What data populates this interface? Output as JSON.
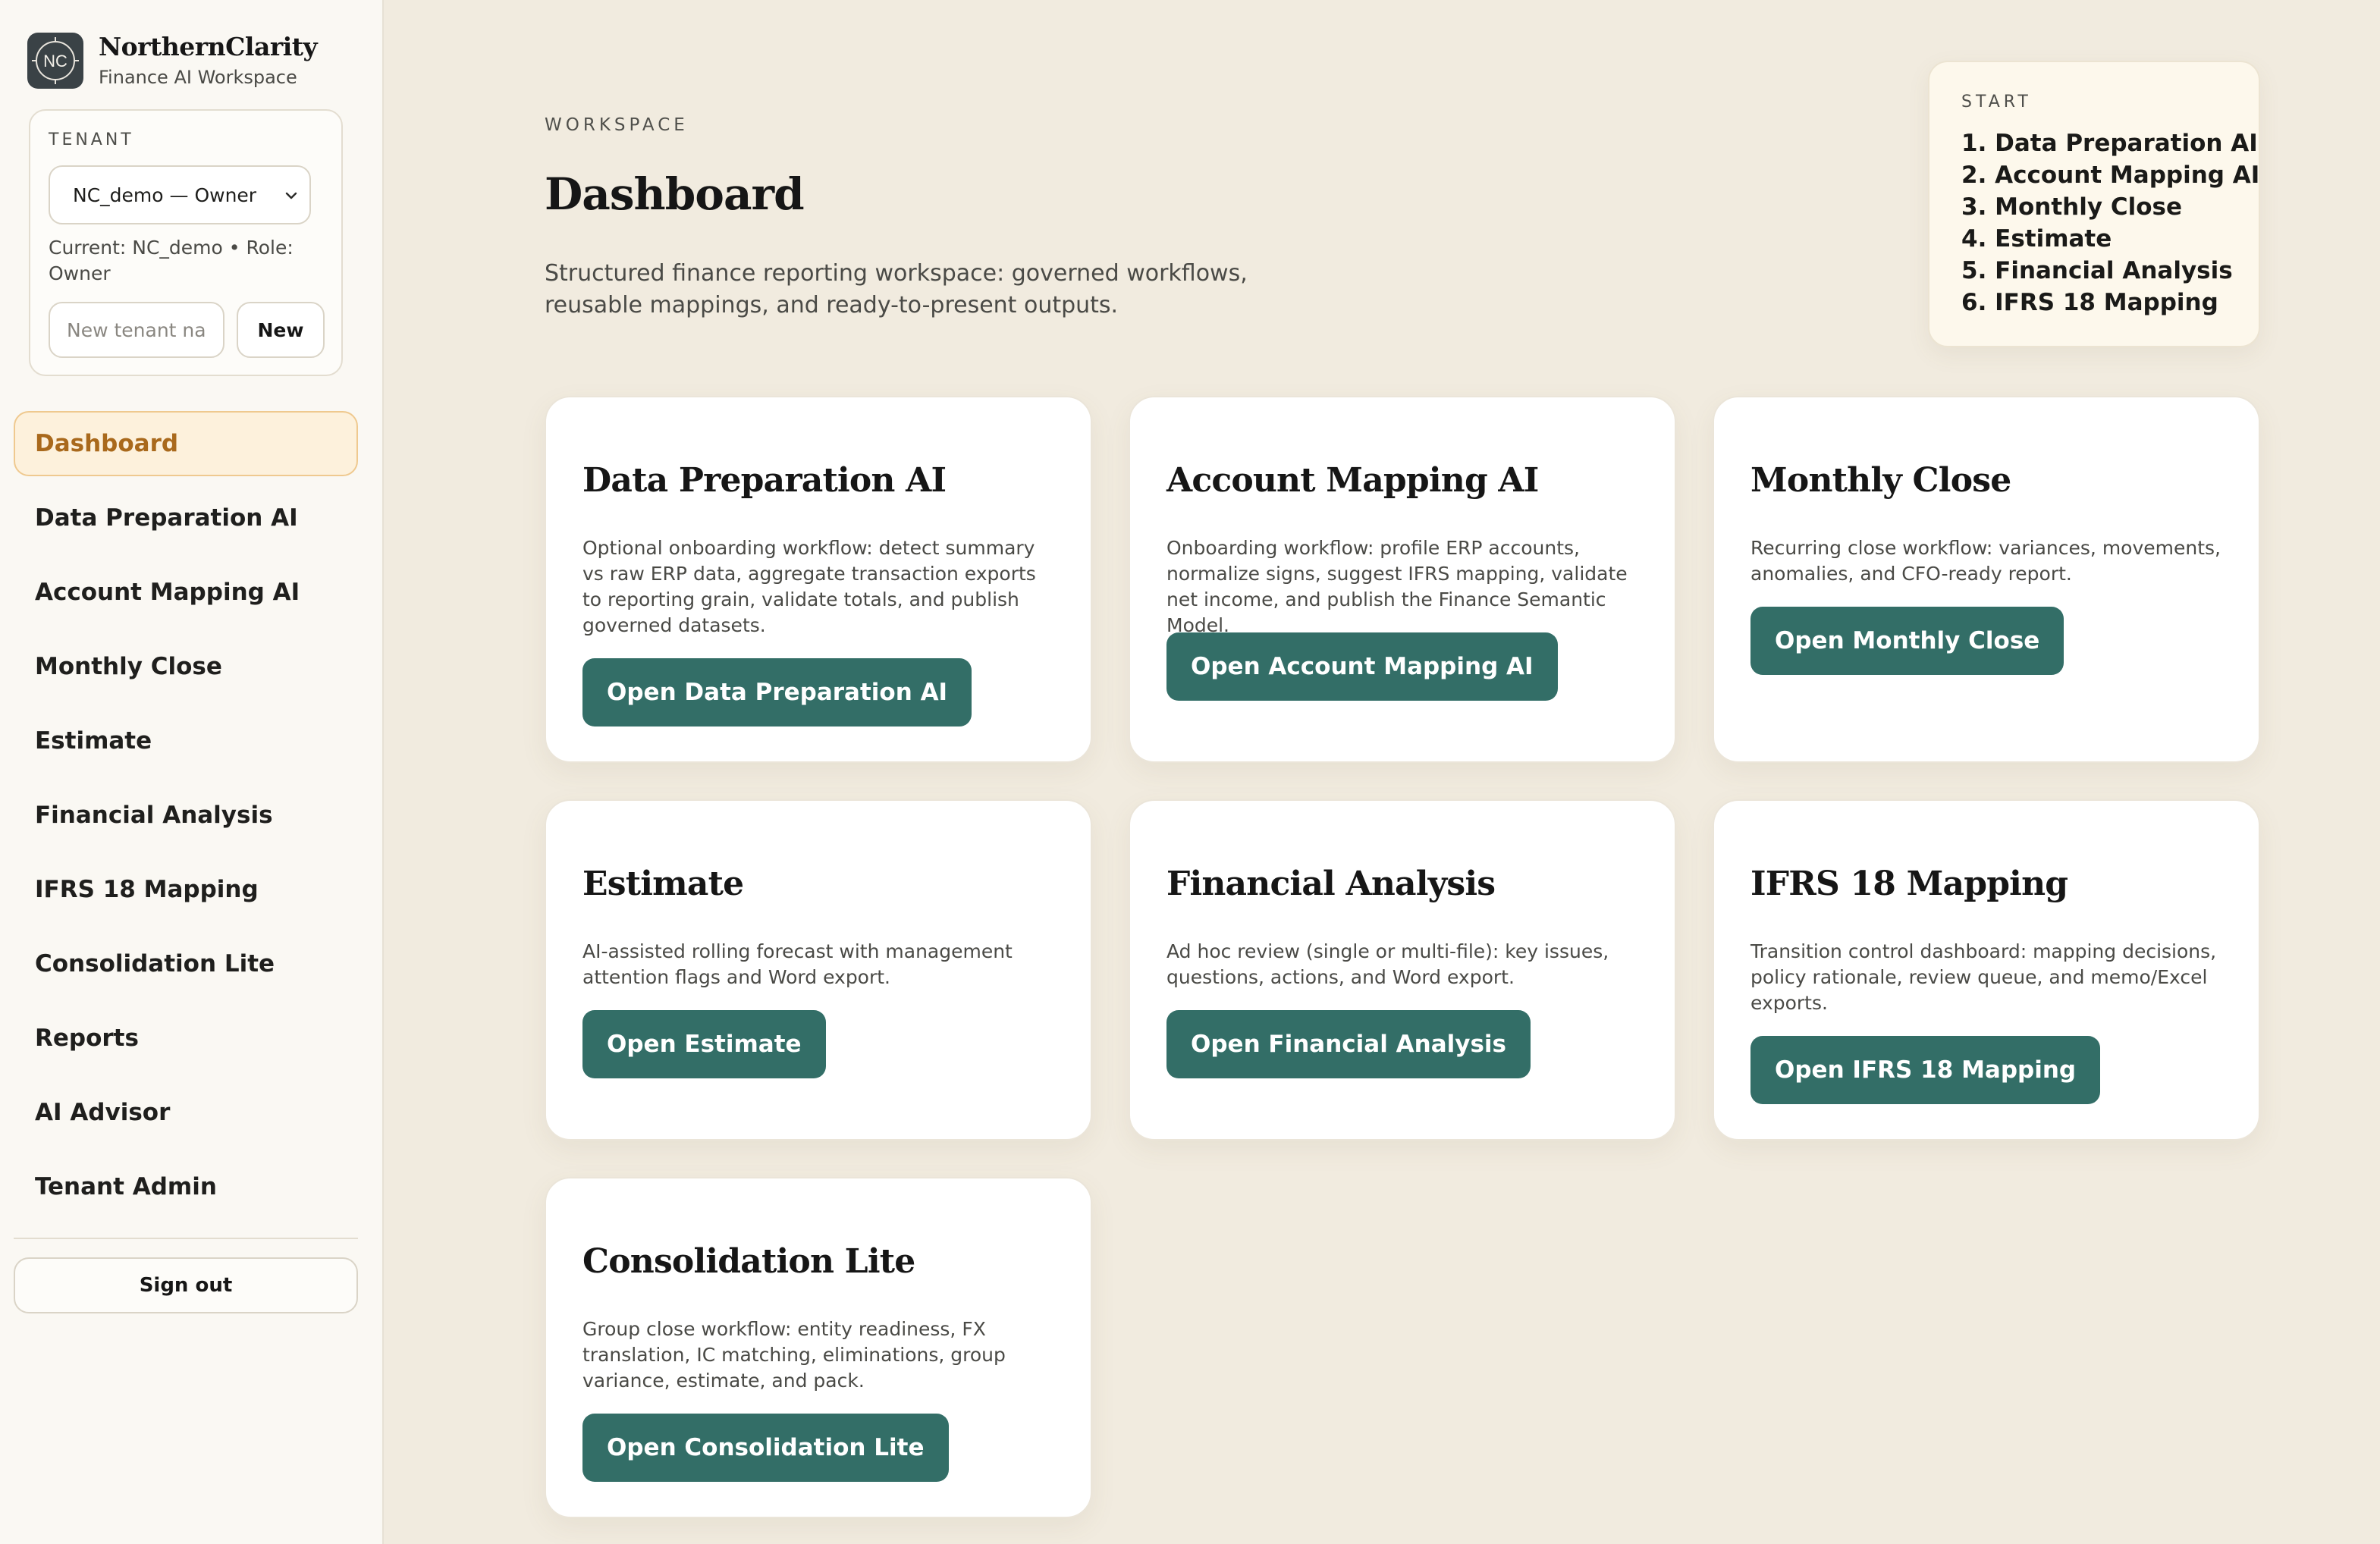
{
  "brand": {
    "logo_text": "NC",
    "name": "NorthernClarity",
    "subtitle": "Finance AI Workspace"
  },
  "tenant": {
    "label": "TENANT",
    "selected": "NC_demo — Owner",
    "current": "Current: NC_demo • Role: Owner",
    "new_placeholder": "New tenant name",
    "new_button": "New"
  },
  "nav": {
    "items": [
      {
        "label": "Dashboard",
        "active": true
      },
      {
        "label": "Data Preparation AI"
      },
      {
        "label": "Account Mapping AI"
      },
      {
        "label": "Monthly Close"
      },
      {
        "label": "Estimate"
      },
      {
        "label": "Financial Analysis"
      },
      {
        "label": "IFRS 18 Mapping"
      },
      {
        "label": "Consolidation Lite"
      },
      {
        "label": "Reports"
      },
      {
        "label": "AI Advisor"
      },
      {
        "label": "Tenant Admin"
      }
    ],
    "signout": "Sign out"
  },
  "header": {
    "eyebrow": "WORKSPACE",
    "title": "Dashboard",
    "description": "Structured finance reporting workspace: governed workflows, reusable mappings, and ready-to-present outputs."
  },
  "start": {
    "label": "START",
    "steps": [
      "1. Data Preparation AI",
      "2. Account Mapping AI",
      "3. Monthly Close",
      "4. Estimate",
      "5. Financial Analysis",
      "6. IFRS 18 Mapping"
    ]
  },
  "cards": [
    {
      "title": "Data Preparation AI",
      "description": "Optional onboarding workflow: detect summary vs raw ERP data, aggregate transaction exports to reporting grain, validate totals, and publish governed datasets.",
      "button": "Open Data Preparation AI"
    },
    {
      "title": "Account Mapping AI",
      "description": "Onboarding workflow: profile ERP accounts, normalize signs, suggest IFRS mapping, validate net income, and publish the Finance Semantic Model.",
      "button": "Open Account Mapping AI"
    },
    {
      "title": "Monthly Close",
      "description": "Recurring close workflow: variances, movements, anomalies, and CFO-ready report.",
      "button": "Open Monthly Close"
    },
    {
      "title": "Estimate",
      "description": "AI-assisted rolling forecast with management attention flags and Word export.",
      "button": "Open Estimate"
    },
    {
      "title": "Financial Analysis",
      "description": "Ad hoc review (single or multi-file): key issues, questions, actions, and Word export.",
      "button": "Open Financial Analysis"
    },
    {
      "title": "IFRS 18 Mapping",
      "description": "Transition control dashboard: mapping decisions, policy rationale, review queue, and memo/Excel exports.",
      "button": "Open IFRS 18 Mapping"
    },
    {
      "title": "Consolidation Lite",
      "description": "Group close workflow: entity readiness, FX translation, IC matching, eliminations, group variance, estimate, and pack.",
      "button": "Open Consolidation Lite"
    }
  ],
  "colors": {
    "accent": "#336e67",
    "active_nav_bg": "#fdf1dc",
    "active_nav_border": "#efc98f",
    "active_nav_text": "#a9691c",
    "page_bg": "#f1ebdf",
    "sidebar_bg": "#faf8f3"
  }
}
